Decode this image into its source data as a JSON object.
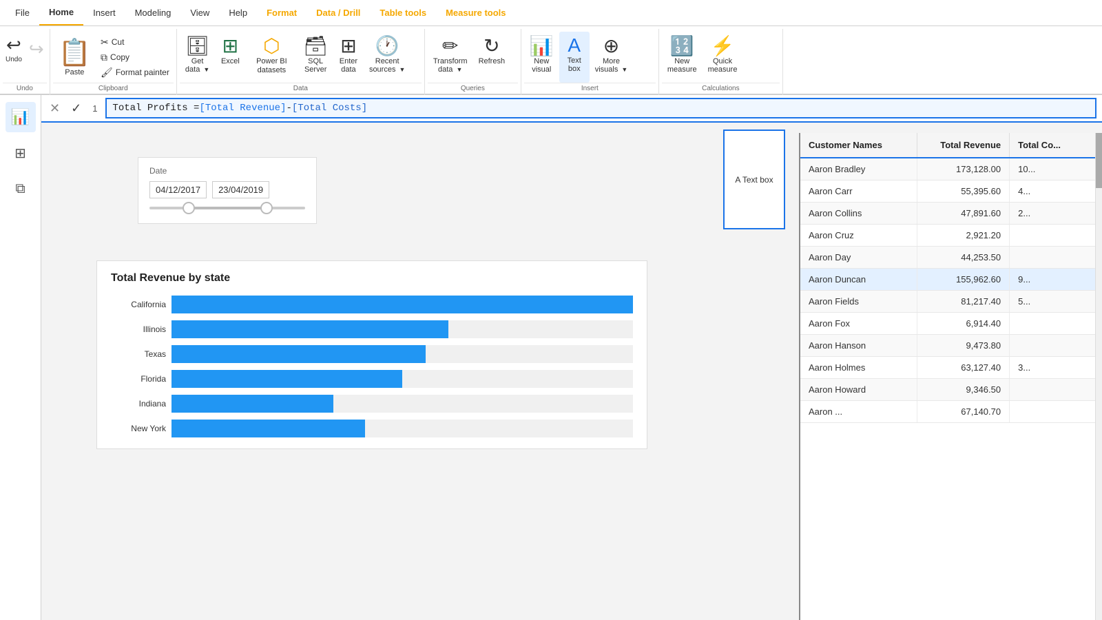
{
  "menubar": {
    "items": [
      {
        "id": "file",
        "label": "File",
        "active": false,
        "colored": false
      },
      {
        "id": "home",
        "label": "Home",
        "active": true,
        "colored": false
      },
      {
        "id": "insert",
        "label": "Insert",
        "active": false,
        "colored": false
      },
      {
        "id": "modeling",
        "label": "Modeling",
        "active": false,
        "colored": false
      },
      {
        "id": "view",
        "label": "View",
        "active": false,
        "colored": false
      },
      {
        "id": "help",
        "label": "Help",
        "active": false,
        "colored": false
      },
      {
        "id": "format",
        "label": "Format",
        "active": false,
        "colored": true,
        "color": "#f5a800"
      },
      {
        "id": "data_drill",
        "label": "Data / Drill",
        "active": false,
        "colored": true,
        "color": "#f5a800"
      },
      {
        "id": "table_tools",
        "label": "Table tools",
        "active": false,
        "colored": true,
        "color": "#f5a800"
      },
      {
        "id": "measure_tools",
        "label": "Measure tools",
        "active": false,
        "colored": true,
        "color": "#f5a800"
      }
    ]
  },
  "ribbon": {
    "undo_label": "Undo",
    "redo_label": "",
    "clipboard": {
      "section_label": "Clipboard",
      "paste_label": "Paste",
      "cut_label": "Cut",
      "copy_label": "Copy",
      "format_painter_label": "Format painter"
    },
    "data": {
      "section_label": "Data",
      "get_data_label": "Get data",
      "excel_label": "Excel",
      "power_bi_label": "Power BI datasets",
      "sql_label": "SQL Server",
      "enter_data_label": "Enter data",
      "recent_sources_label": "Recent sources"
    },
    "queries": {
      "section_label": "Queries",
      "transform_label": "Transform data",
      "refresh_label": "Refresh"
    },
    "insert": {
      "section_label": "Insert",
      "new_visual_label": "New visual",
      "text_box_label": "Text box",
      "more_visuals_label": "More visuals"
    },
    "calculations": {
      "section_label": "Calculations",
      "new_measure_label": "New measure",
      "quick_measure_label": "Quick measure"
    }
  },
  "formula_bar": {
    "cancel_label": "✕",
    "confirm_label": "✓",
    "row_num": "1",
    "formula": "Total Profits = [Total Revenue] - [Total Costs]",
    "formula_parts": [
      {
        "text": "Total Profits = ",
        "color": "black"
      },
      {
        "text": "[Total Revenue]",
        "color": "blue"
      },
      {
        "text": " - ",
        "color": "black"
      },
      {
        "text": "[Total Costs]",
        "color": "blue"
      }
    ]
  },
  "sidebar": {
    "items": [
      {
        "id": "report",
        "icon": "📊",
        "active": true
      },
      {
        "id": "table",
        "icon": "⊞",
        "active": false
      },
      {
        "id": "model",
        "icon": "⧉",
        "active": false
      }
    ]
  },
  "date_filter": {
    "label": "Date",
    "start_date": "04/12/2017",
    "end_date": "23/04/2019"
  },
  "bar_chart": {
    "title": "Total Revenue by state",
    "bars": [
      {
        "label": "California",
        "value": 100,
        "display": ""
      },
      {
        "label": "Illinois",
        "value": 60,
        "display": ""
      },
      {
        "label": "Texas",
        "value": 55,
        "display": ""
      },
      {
        "label": "Florida",
        "value": 50,
        "display": ""
      },
      {
        "label": "Indiana",
        "value": 35,
        "display": ""
      },
      {
        "label": "New York",
        "value": 42,
        "display": ""
      }
    ]
  },
  "data_table": {
    "columns": [
      {
        "id": "customer_names",
        "label": "Customer Names"
      },
      {
        "id": "total_revenue",
        "label": "Total Revenue"
      },
      {
        "id": "total_costs",
        "label": "Total Co..."
      }
    ],
    "rows": [
      {
        "customer": "Aaron Bradley",
        "revenue": "173,128.00",
        "costs": "10...",
        "selected": false
      },
      {
        "customer": "Aaron Carr",
        "revenue": "55,395.60",
        "costs": "4...",
        "selected": false
      },
      {
        "customer": "Aaron Collins",
        "revenue": "47,891.60",
        "costs": "2...",
        "selected": false
      },
      {
        "customer": "Aaron Cruz",
        "revenue": "2,921.20",
        "costs": "",
        "selected": false
      },
      {
        "customer": "Aaron Day",
        "revenue": "44,253.50",
        "costs": "",
        "selected": false
      },
      {
        "customer": "Aaron Duncan",
        "revenue": "155,962.60",
        "costs": "9...",
        "selected": true
      },
      {
        "customer": "Aaron Fields",
        "revenue": "81,217.40",
        "costs": "5...",
        "selected": false
      },
      {
        "customer": "Aaron Fox",
        "revenue": "6,914.40",
        "costs": "",
        "selected": false
      },
      {
        "customer": "Aaron Hanson",
        "revenue": "9,473.80",
        "costs": "",
        "selected": false
      },
      {
        "customer": "Aaron Holmes",
        "revenue": "63,127.40",
        "costs": "3...",
        "selected": false
      },
      {
        "customer": "Aaron Howard",
        "revenue": "9,346.50",
        "costs": "",
        "selected": false
      },
      {
        "customer": "Aaron ...",
        "revenue": "67,140.70",
        "costs": "",
        "selected": false
      }
    ]
  },
  "text_box": {
    "label": "A Text box"
  },
  "colors": {
    "accent_blue": "#1a73e8",
    "bar_blue": "#2196f3",
    "ribbon_orange": "#f5a800",
    "selected_row": "#e3f0ff"
  }
}
